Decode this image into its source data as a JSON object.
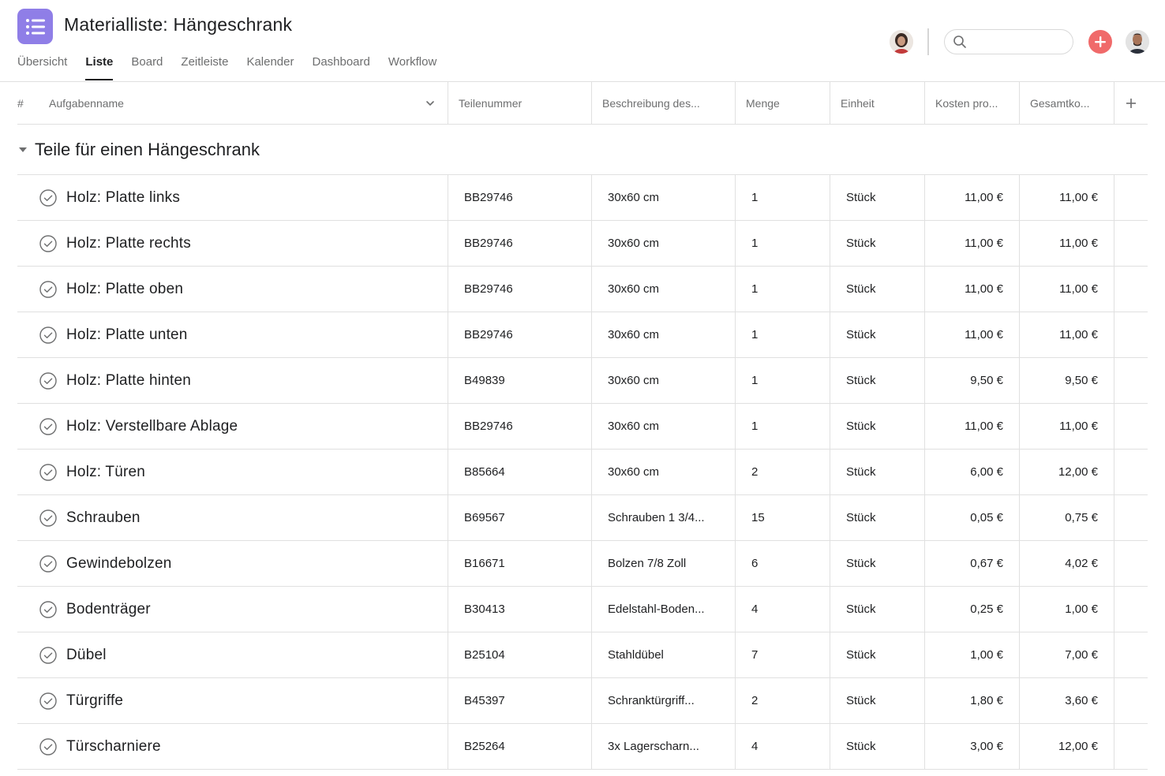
{
  "app": {
    "title": "Materialliste: Hängeschrank",
    "icon": "list-icon",
    "icon_color": "#8f7ee7"
  },
  "tabs": [
    {
      "label": "Übersicht",
      "active": false
    },
    {
      "label": "Liste",
      "active": true
    },
    {
      "label": "Board",
      "active": false
    },
    {
      "label": "Zeitleiste",
      "active": false
    },
    {
      "label": "Kalender",
      "active": false
    },
    {
      "label": "Dashboard",
      "active": false
    },
    {
      "label": "Workflow",
      "active": false
    }
  ],
  "search": {
    "value": "",
    "placeholder": ""
  },
  "accent_add_color": "#f06a6a",
  "columns": {
    "hash": "#",
    "name": "Aufgabenname",
    "part_number": "Teilenummer",
    "description": "Beschreibung des...",
    "quantity": "Menge",
    "unit": "Einheit",
    "unit_cost": "Kosten pro...",
    "total_cost": "Gesamtko..."
  },
  "section": {
    "title": "Teile für einen Hängeschrank"
  },
  "rows": [
    {
      "name": "Holz: Platte links",
      "part": "BB29746",
      "desc": "30x60 cm",
      "qty": "1",
      "unit": "Stück",
      "cost": "11,00 €",
      "total": "11,00 €"
    },
    {
      "name": "Holz: Platte rechts",
      "part": "BB29746",
      "desc": "30x60 cm",
      "qty": "1",
      "unit": "Stück",
      "cost": "11,00 €",
      "total": "11,00 €"
    },
    {
      "name": "Holz: Platte oben",
      "part": "BB29746",
      "desc": "30x60 cm",
      "qty": "1",
      "unit": "Stück",
      "cost": "11,00 €",
      "total": "11,00 €"
    },
    {
      "name": "Holz: Platte unten",
      "part": "BB29746",
      "desc": "30x60 cm",
      "qty": "1",
      "unit": "Stück",
      "cost": "11,00 €",
      "total": "11,00 €"
    },
    {
      "name": "Holz: Platte hinten",
      "part": "B49839",
      "desc": "30x60 cm",
      "qty": "1",
      "unit": "Stück",
      "cost": "9,50 €",
      "total": "9,50 €"
    },
    {
      "name": "Holz: Verstellbare Ablage",
      "part": "BB29746",
      "desc": "30x60 cm",
      "qty": "1",
      "unit": "Stück",
      "cost": "11,00 €",
      "total": "11,00 €"
    },
    {
      "name": "Holz: Türen",
      "part": "B85664",
      "desc": "30x60 cm",
      "qty": "2",
      "unit": "Stück",
      "cost": "6,00 €",
      "total": "12,00 €"
    },
    {
      "name": "Schrauben",
      "part": "B69567",
      "desc": "Schrauben 1 3/4...",
      "qty": "15",
      "unit": "Stück",
      "cost": "0,05 €",
      "total": "0,75 €"
    },
    {
      "name": "Gewindebolzen",
      "part": "B16671",
      "desc": "Bolzen 7/8 Zoll",
      "qty": "6",
      "unit": "Stück",
      "cost": "0,67 €",
      "total": "4,02 €"
    },
    {
      "name": "Bodenträger",
      "part": "B30413",
      "desc": "Edelstahl-Boden...",
      "qty": "4",
      "unit": "Stück",
      "cost": "0,25 €",
      "total": "1,00 €"
    },
    {
      "name": "Dübel",
      "part": "B25104",
      "desc": "Stahldübel",
      "qty": "7",
      "unit": "Stück",
      "cost": "1,00 €",
      "total": "7,00 €"
    },
    {
      "name": "Türgriffe",
      "part": "B45397",
      "desc": "Schranktürgriff...",
      "qty": "2",
      "unit": "Stück",
      "cost": "1,80 €",
      "total": "3,60 €"
    },
    {
      "name": "Türscharniere",
      "part": "B25264",
      "desc": "3x Lagerscharn...",
      "qty": "4",
      "unit": "Stück",
      "cost": "3,00 €",
      "total": "12,00 €"
    }
  ]
}
